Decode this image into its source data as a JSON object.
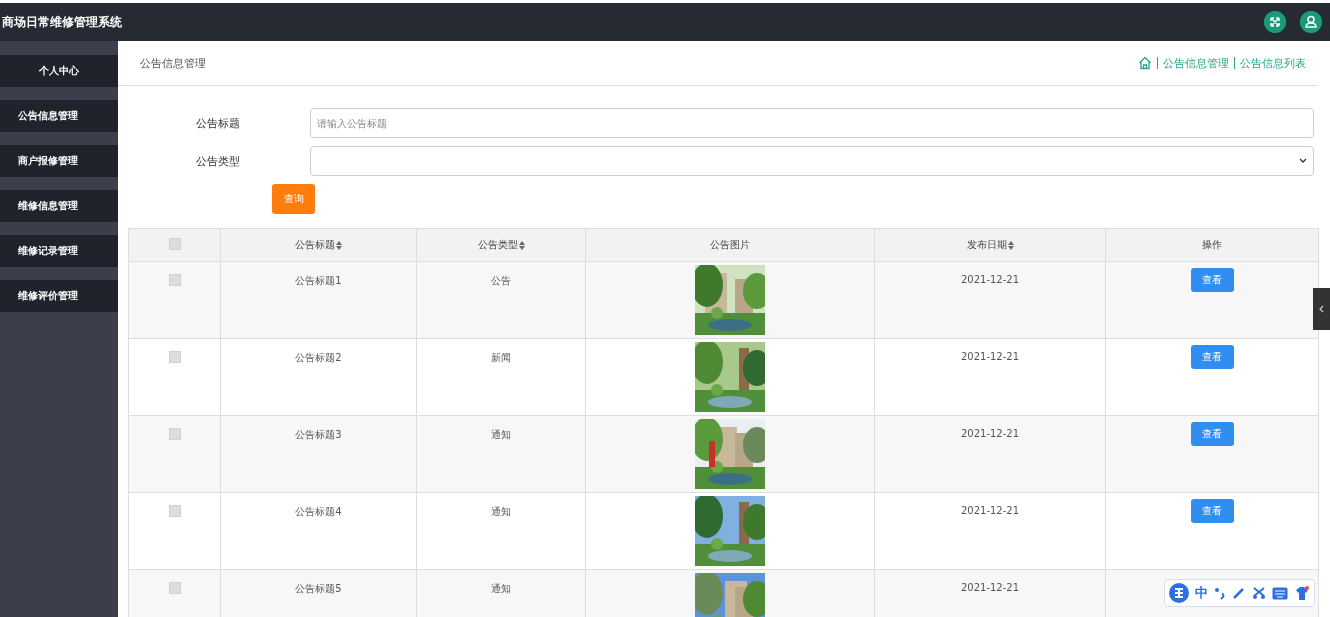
{
  "app_title": "商场日常维修管理系统",
  "sidebar": {
    "items": [
      {
        "label": "个人中心"
      },
      {
        "label": "公告信息管理"
      },
      {
        "label": "商户报修管理"
      },
      {
        "label": "维修信息管理"
      },
      {
        "label": "维修记录管理"
      },
      {
        "label": "维修评价管理"
      }
    ]
  },
  "page_title": "公告信息管理",
  "breadcrumb": [
    "公告信息管理",
    "公告信息列表"
  ],
  "filters": [
    {
      "kind": "text",
      "label": "公告标题",
      "placeholder": "请输入公告标题"
    },
    {
      "kind": "select",
      "label": "公告类型"
    }
  ],
  "search_button": "查询",
  "table": {
    "all_checked": false,
    "columns": [
      {
        "kind": "check"
      },
      {
        "label": "公告标题",
        "sortable": true
      },
      {
        "label": "公告类型",
        "sortable": true
      },
      {
        "label": "公告图片",
        "sortable": false
      },
      {
        "label": "发布日期",
        "sortable": true
      },
      {
        "label": "操作",
        "sortable": false
      }
    ],
    "rows": [
      {
        "checked": false,
        "title": "公告标题1",
        "type": "公告",
        "date": "2021-12-21",
        "action": "查看"
      },
      {
        "checked": false,
        "title": "公告标题2",
        "type": "新闻",
        "date": "2021-12-21",
        "action": "查看"
      },
      {
        "checked": false,
        "title": "公告标题3",
        "type": "通知",
        "date": "2021-12-21",
        "action": "查看"
      },
      {
        "checked": false,
        "title": "公告标题4",
        "type": "通知",
        "date": "2021-12-21",
        "action": "查看"
      },
      {
        "checked": false,
        "title": "公告标题5",
        "type": "通知",
        "date": "2021-12-21"
      }
    ]
  },
  "ime_toolbar": {
    "mode": "中"
  }
}
